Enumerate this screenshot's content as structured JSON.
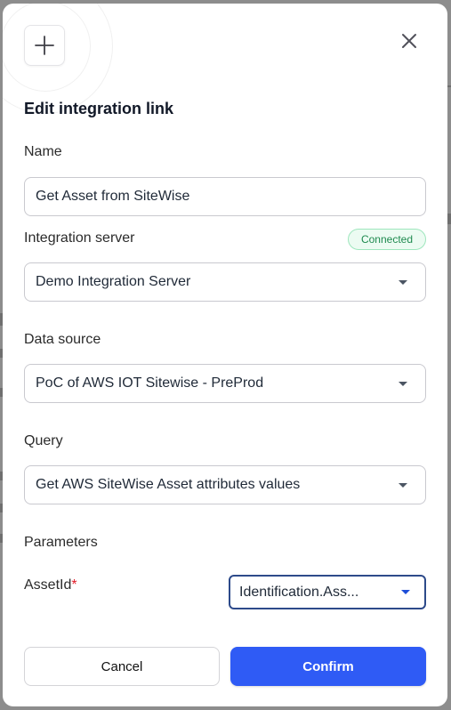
{
  "dialog": {
    "title": "Edit integration link",
    "close_icon": "close-icon",
    "header_icon": "plus-icon"
  },
  "form": {
    "name_label": "Name",
    "name_value": "Get Asset from SiteWise",
    "server_label": "Integration server",
    "server_status": "Connected",
    "server_value": "Demo Integration Server",
    "datasource_label": "Data source",
    "datasource_value": "PoC of AWS IOT Sitewise - PreProd",
    "query_label": "Query",
    "query_value": "Get AWS SiteWise Asset attributes values",
    "parameters_label": "Parameters",
    "param_name": "AssetId",
    "param_required_mark": "*",
    "param_value": "Identification.Ass..."
  },
  "actions": {
    "cancel_label": "Cancel",
    "confirm_label": "Confirm"
  },
  "colors": {
    "accent": "#2f5bf5",
    "status_green": "#1f8a4f",
    "required_red": "#e11d2a"
  }
}
